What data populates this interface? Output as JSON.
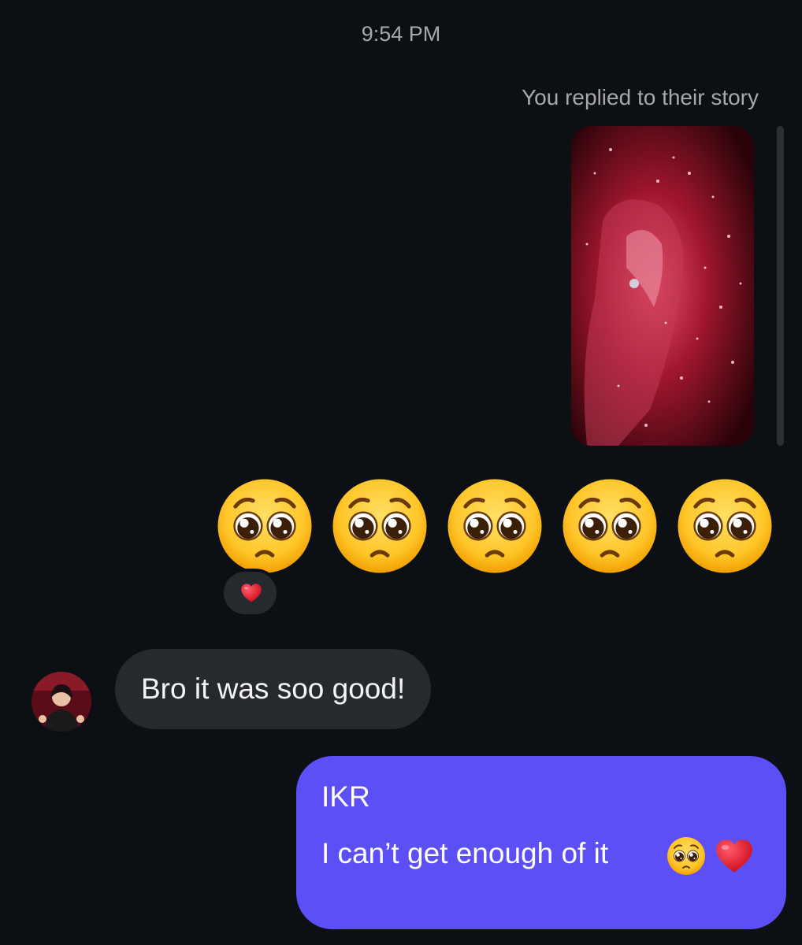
{
  "chat": {
    "timestamp": "9:54 PM",
    "story_reply_caption": "You replied to their story"
  },
  "sent_emoji_message": {
    "emoji_name": "pleading-face-emoji",
    "emoji_count": 5,
    "reaction": "heart-icon"
  },
  "messages": [
    {
      "sender": "them",
      "text": "Bro it was soo good!"
    },
    {
      "sender": "me",
      "line1": "IKR",
      "line2": "I can’t get enough of it",
      "trailing_emojis": [
        "pleading-face-emoji",
        "heart-icon"
      ]
    }
  ],
  "colors": {
    "background": "#0c1014",
    "incoming_bubble": "#262a2f",
    "outgoing_bubble": "#5b4ff5",
    "secondary_text": "#a8a8a8",
    "heart": "#e0172f"
  }
}
